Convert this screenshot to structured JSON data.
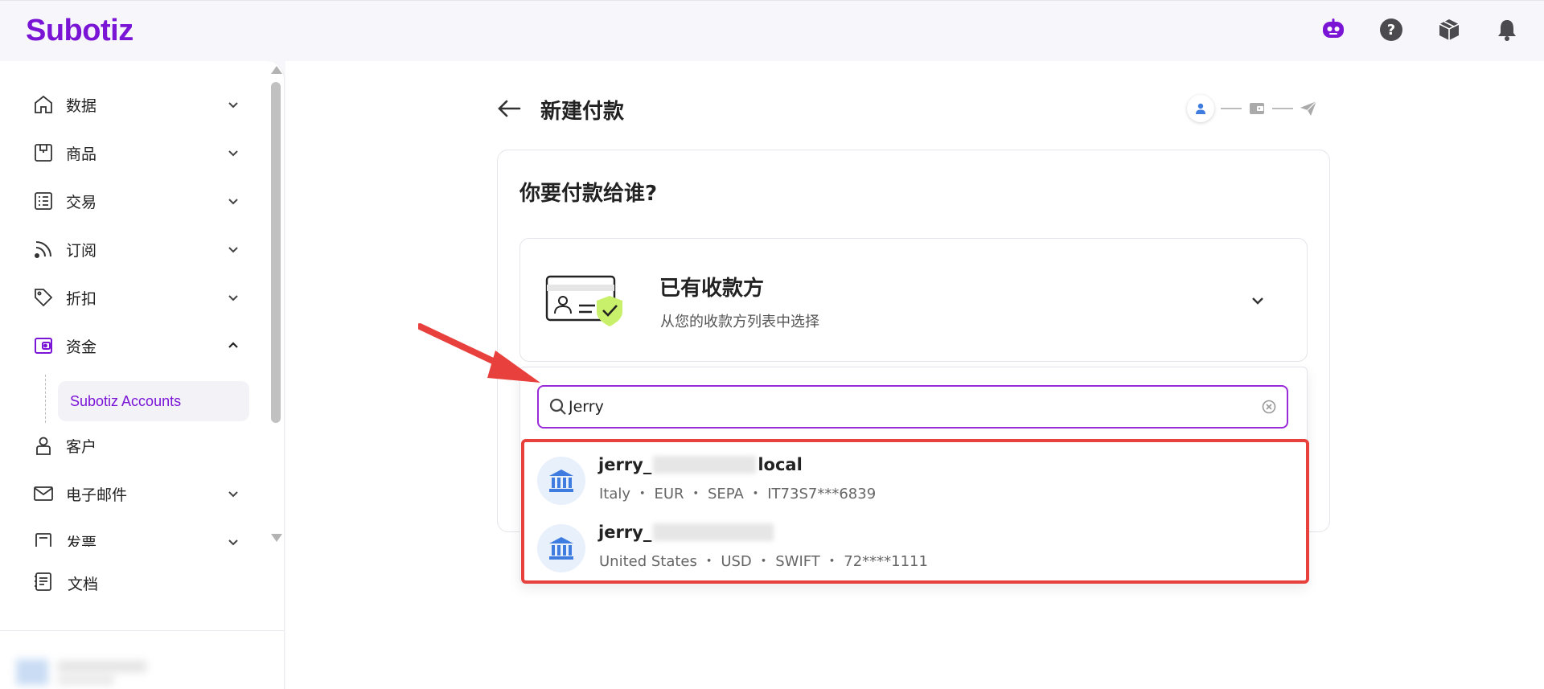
{
  "app": {
    "logo": "Subotiz",
    "brand_color": "#7b15d6"
  },
  "topbar": {
    "icons": [
      "ai-assistant-icon",
      "help-icon",
      "package-icon",
      "notification-bell-icon"
    ]
  },
  "sidebar": {
    "items": [
      {
        "label": "数据",
        "icon": "home-icon",
        "expanded": false
      },
      {
        "label": "商品",
        "icon": "store-icon",
        "expanded": false
      },
      {
        "label": "交易",
        "icon": "list-icon",
        "expanded": false
      },
      {
        "label": "订阅",
        "icon": "rss-icon",
        "expanded": false
      },
      {
        "label": "折扣",
        "icon": "tag-icon",
        "expanded": false
      },
      {
        "label": "资金",
        "icon": "wallet-icon",
        "expanded": true
      },
      {
        "label": "客户",
        "icon": "user-icon",
        "expanded": false
      },
      {
        "label": "电子邮件",
        "icon": "mail-icon",
        "expanded": false
      },
      {
        "label": "发票",
        "icon": "invoice-icon",
        "expanded": false
      }
    ],
    "sub_item": "Subotiz Accounts",
    "doc_item": "文档"
  },
  "main": {
    "page_title": "新建付款",
    "card_heading": "你要付款给谁?",
    "payee": {
      "title": "已有收款方",
      "subtitle": "从您的收款方列表中选择"
    },
    "search": {
      "value": "Jerry"
    },
    "results": [
      {
        "name_prefix": "jerry_",
        "name_suffix": "local",
        "meta": "Italy ・ EUR ・ SEPA ・ IT73S7***6839"
      },
      {
        "name_prefix": "jerry_",
        "name_suffix": "",
        "meta": "United States ・ USD ・ SWIFT ・ 72****1111"
      }
    ]
  },
  "colors": {
    "accent": "#7b15d6",
    "highlight": "#e8403c",
    "bank_icon": "#3f7ce0"
  }
}
